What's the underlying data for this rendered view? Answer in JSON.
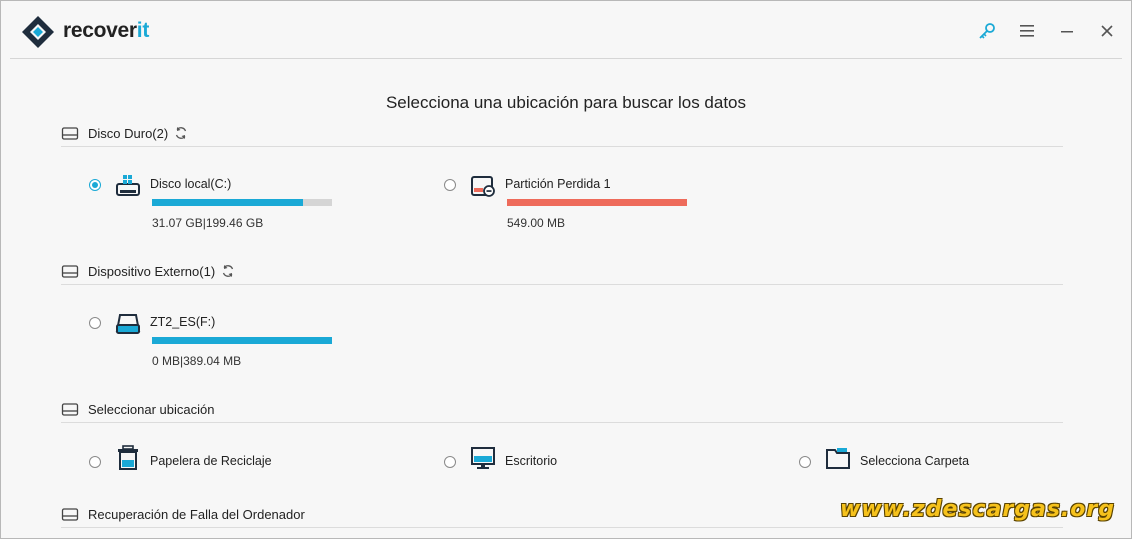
{
  "app": {
    "brand_part1": "recover",
    "brand_part2": "it"
  },
  "colors": {
    "accent": "#1aa9d6",
    "lost_partition": "#ee6b5b",
    "bar_empty": "#d5d5d5"
  },
  "title": "Selecciona una ubicación para buscar los datos",
  "sections": {
    "hard_disk": {
      "label": "Disco Duro(2)",
      "items": [
        {
          "label": "Disco local(C:)",
          "size": "31.07  GB|199.46  GB",
          "usage": 0.84,
          "selected": true,
          "icon": "local-disk-icon"
        },
        {
          "label": "Partición Perdida 1",
          "size": "549.00  MB",
          "usage": 1.0,
          "selected": false,
          "icon": "lost-partition-icon"
        }
      ]
    },
    "external": {
      "label": "Dispositivo Externo(1)",
      "items": [
        {
          "label": "ZT2_ES(F:)",
          "size": "0 MB|389.04  MB",
          "usage": 1.0,
          "selected": false,
          "icon": "external-drive-icon"
        }
      ]
    },
    "location": {
      "label": "Seleccionar ubicación",
      "items": [
        {
          "label": "Papelera de Reciclaje",
          "icon": "recycle-bin-icon"
        },
        {
          "label": "Escritorio",
          "icon": "desktop-icon"
        },
        {
          "label": "Selecciona Carpeta",
          "icon": "folder-icon"
        }
      ]
    },
    "crash": {
      "label": "Recuperación de Falla del Ordenador"
    }
  },
  "watermark": "www.zdescargas.org"
}
